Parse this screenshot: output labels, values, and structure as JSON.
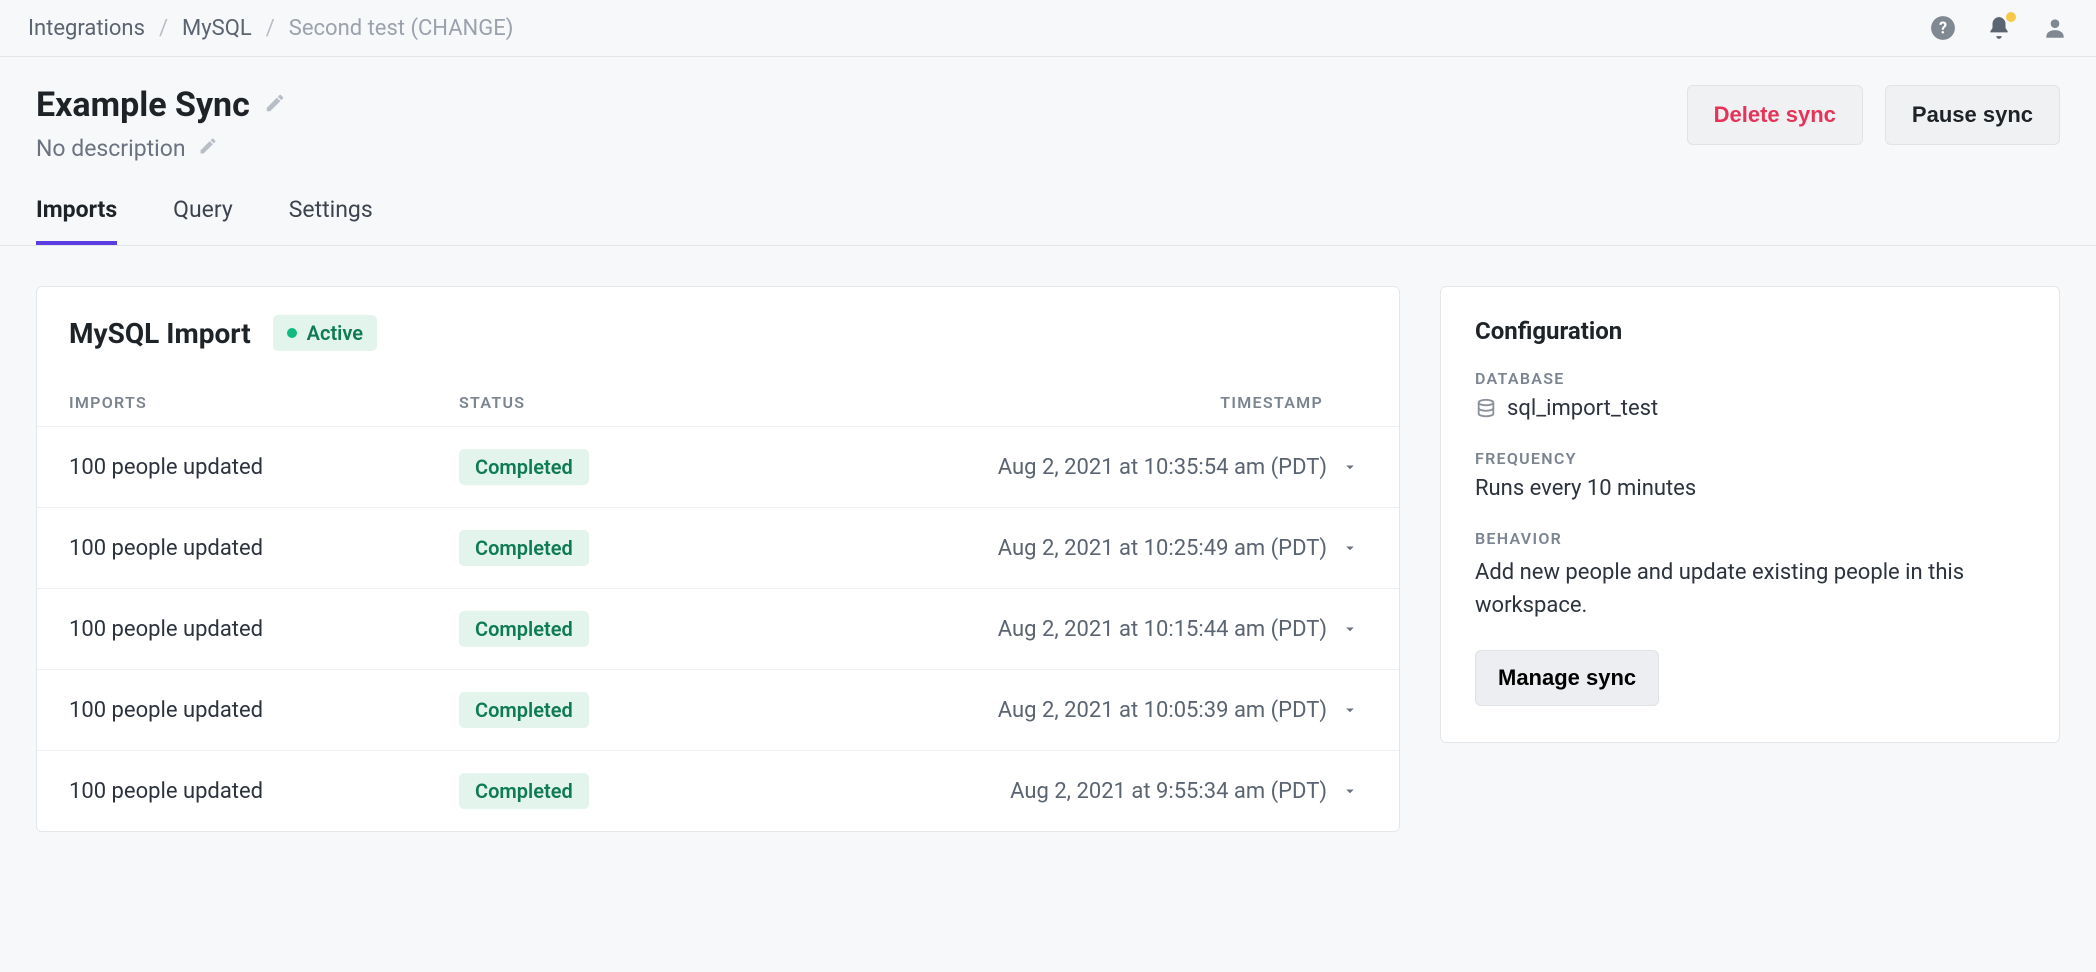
{
  "breadcrumb": {
    "items": [
      {
        "label": "Integrations"
      },
      {
        "label": "MySQL"
      },
      {
        "label": "Second test (CHANGE)"
      }
    ]
  },
  "header": {
    "title": "Example Sync",
    "description": "No description",
    "delete_label": "Delete sync",
    "pause_label": "Pause sync"
  },
  "tabs": [
    {
      "label": "Imports",
      "active": true
    },
    {
      "label": "Query",
      "active": false
    },
    {
      "label": "Settings",
      "active": false
    }
  ],
  "main": {
    "title": "MySQL Import",
    "status_chip": "Active",
    "columns": {
      "imports": "Imports",
      "status": "Status",
      "timestamp": "Timestamp"
    },
    "rows": [
      {
        "imports": "100 people updated",
        "status": "Completed",
        "timestamp": "Aug 2, 2021 at 10:35:54 am (PDT)"
      },
      {
        "imports": "100 people updated",
        "status": "Completed",
        "timestamp": "Aug 2, 2021 at 10:25:49 am (PDT)"
      },
      {
        "imports": "100 people updated",
        "status": "Completed",
        "timestamp": "Aug 2, 2021 at 10:15:44 am (PDT)"
      },
      {
        "imports": "100 people updated",
        "status": "Completed",
        "timestamp": "Aug 2, 2021 at 10:05:39 am (PDT)"
      },
      {
        "imports": "100 people updated",
        "status": "Completed",
        "timestamp": "Aug 2, 2021 at 9:55:34 am (PDT)"
      }
    ]
  },
  "config": {
    "title": "Configuration",
    "database_label": "Database",
    "database_value": "sql_import_test",
    "frequency_label": "Frequency",
    "frequency_value": "Runs every 10 minutes",
    "behavior_label": "Behavior",
    "behavior_value": "Add new people and update existing people in this workspace.",
    "manage_label": "Manage sync"
  }
}
